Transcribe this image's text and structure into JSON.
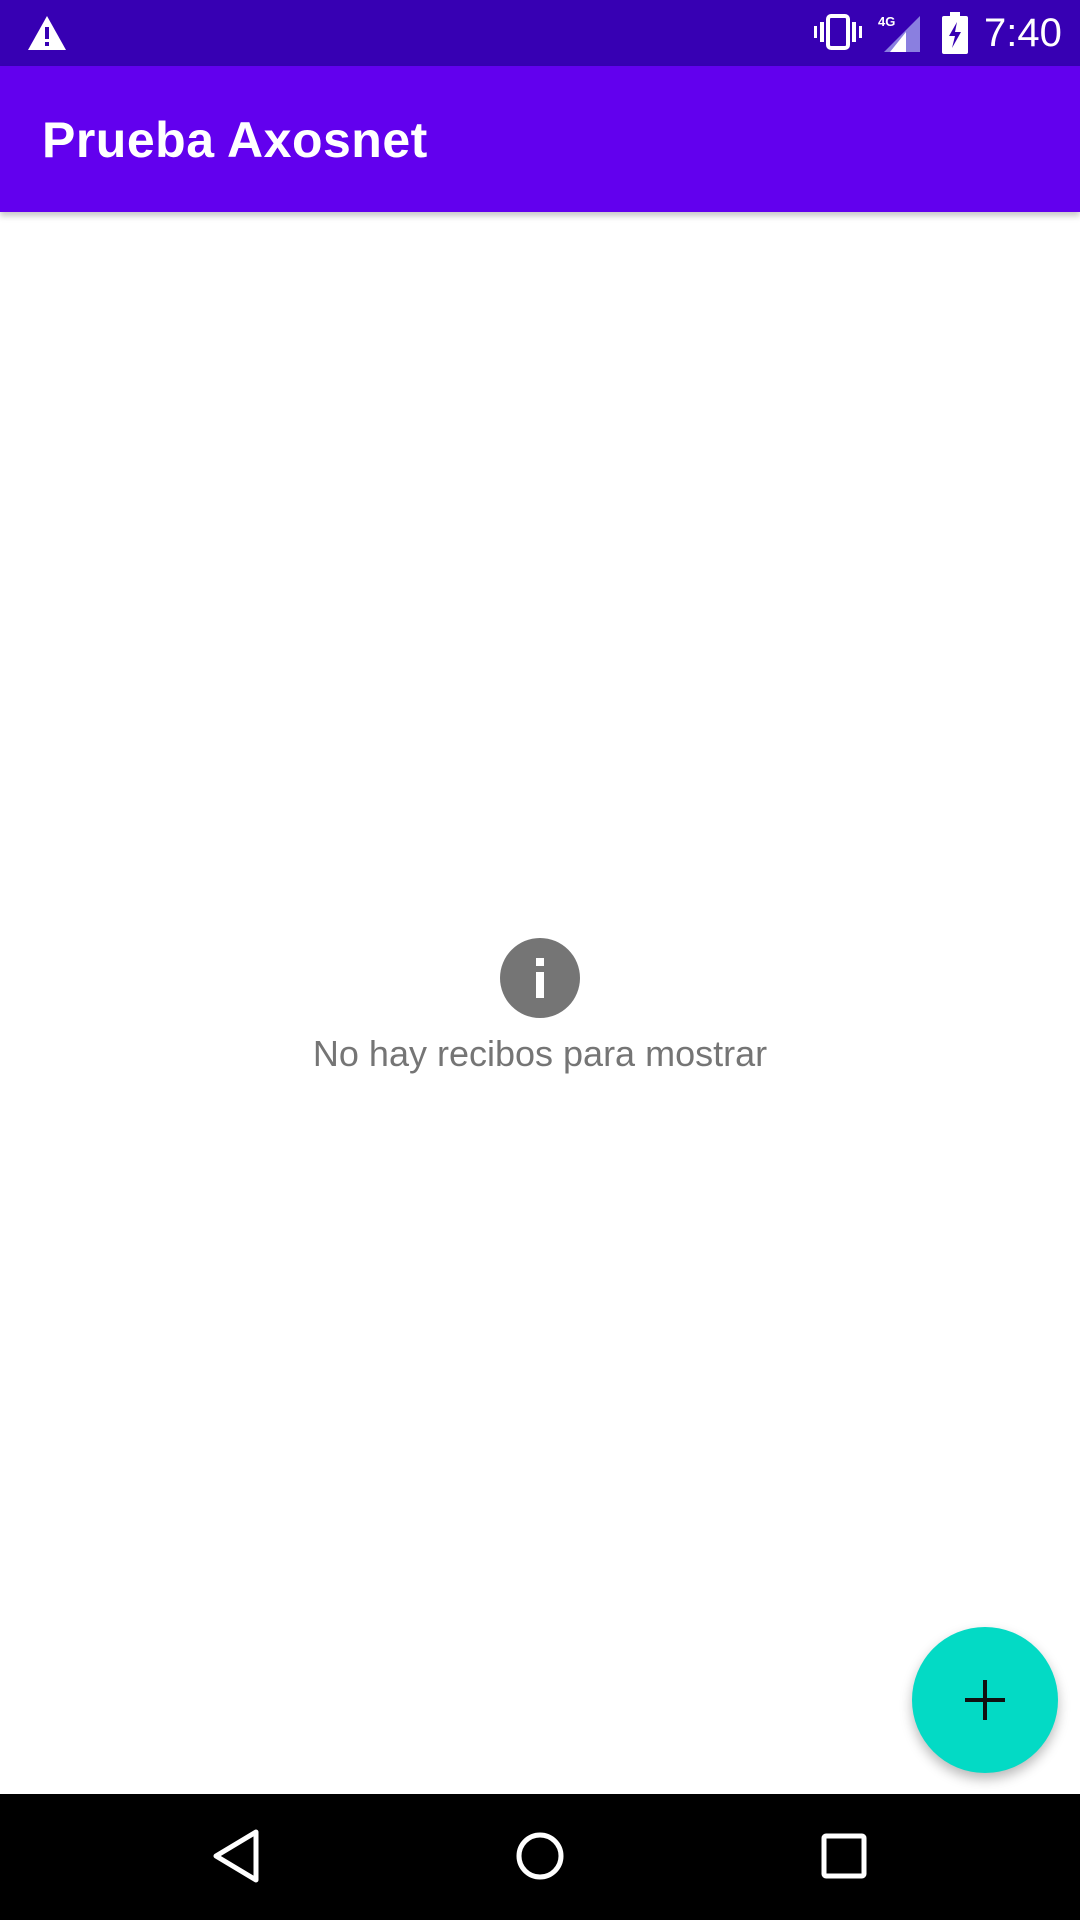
{
  "status_bar": {
    "time": "7:40",
    "network_label": "4G",
    "icons": [
      "warning-icon",
      "vibrate-icon",
      "cell-signal-icon",
      "battery-charging-icon"
    ]
  },
  "app_bar": {
    "title": "Prueba Axosnet"
  },
  "empty_state": {
    "icon": "info-icon",
    "message": "No hay recibos para mostrar"
  },
  "fab": {
    "icon": "plus-icon"
  },
  "nav_bar": {
    "icons": [
      "back-icon",
      "home-icon",
      "recents-icon"
    ]
  },
  "colors": {
    "status_bar": "#3700b3",
    "app_bar": "#6200ee",
    "fab": "#03dac5",
    "empty_text": "#757575"
  }
}
